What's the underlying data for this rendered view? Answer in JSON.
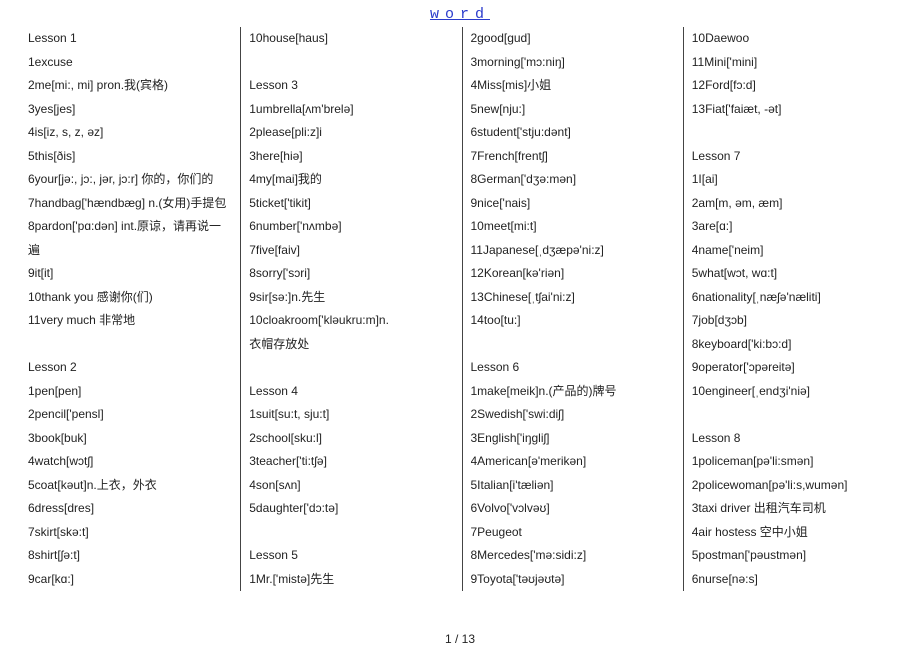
{
  "header": "word",
  "footer": "1  /  13",
  "columns": [
    [
      {
        "t": "text",
        "v": "Lesson 1"
      },
      {
        "t": "text",
        "v": "1excuse"
      },
      {
        "t": "text",
        "v": "2me[mi:, mi] pron.我(宾格)"
      },
      {
        "t": "text",
        "v": "3yes[jes]"
      },
      {
        "t": "text",
        "v": "4is[iz, s, z, əz]"
      },
      {
        "t": "text",
        "v": "5this[ðis]"
      },
      {
        "t": "text",
        "v": "6your[jə:, jɔ:, jər, jɔ:r]  你的，你们的"
      },
      {
        "t": "text",
        "v": "7handbag['hændbæg] n.(女用)手提包"
      },
      {
        "t": "text",
        "v": "8pardon['pɑ:dən] int.原谅，请再说一"
      },
      {
        "t": "text",
        "v": "遍"
      },
      {
        "t": "text",
        "v": "9it[it]"
      },
      {
        "t": "text",
        "v": "10thank you 感谢你(们)"
      },
      {
        "t": "text",
        "v": "11very much 非常地"
      },
      {
        "t": "blank"
      },
      {
        "t": "text",
        "v": "Lesson 2"
      },
      {
        "t": "text",
        "v": "1pen[pen]"
      },
      {
        "t": "text",
        "v": "2pencil['pensl]"
      },
      {
        "t": "text",
        "v": "3book[buk]"
      },
      {
        "t": "text",
        "v": "4watch[wɔtʃ]"
      },
      {
        "t": "text",
        "v": "5coat[kəut]n.上衣，外衣"
      },
      {
        "t": "text",
        "v": "6dress[dres]"
      },
      {
        "t": "text",
        "v": "7skirt[skə:t]"
      },
      {
        "t": "text",
        "v": "8shirt[ʃə:t]"
      },
      {
        "t": "text",
        "v": "9car[kɑ:]"
      }
    ],
    [
      {
        "t": "text",
        "v": "10house[haus]"
      },
      {
        "t": "blank"
      },
      {
        "t": "text",
        "v": "Lesson 3"
      },
      {
        "t": "text",
        "v": "1umbrella[ʌm'brelə]"
      },
      {
        "t": "text",
        "v": "2please[pli:z]i"
      },
      {
        "t": "text",
        "v": "3here[hiə]"
      },
      {
        "t": "text",
        "v": "4my[mai]我的"
      },
      {
        "t": "text",
        "v": "5ticket['tikit]"
      },
      {
        "t": "text",
        "v": "6number['nʌmbə]"
      },
      {
        "t": "text",
        "v": "7five[faiv]"
      },
      {
        "t": "text",
        "v": "8sorry['sɔri]"
      },
      {
        "t": "text",
        "v": "9sir[sə:]n.先生"
      },
      {
        "t": "text",
        "v": "10cloakroom['kləukru:m]n."
      },
      {
        "t": "text",
        "v": "衣帽存放处"
      },
      {
        "t": "blank"
      },
      {
        "t": "text",
        "v": "Lesson 4"
      },
      {
        "t": "text",
        "v": "1suit[su:t, sju:t]"
      },
      {
        "t": "text",
        "v": "2school[sku:l]"
      },
      {
        "t": "text",
        "v": "3teacher['ti:tʃə]"
      },
      {
        "t": "text",
        "v": "4son[sʌn]"
      },
      {
        "t": "text",
        "v": "5daughter['dɔ:tə]"
      },
      {
        "t": "blank"
      },
      {
        "t": "text",
        "v": "Lesson 5"
      },
      {
        "t": "text",
        "v": "1Mr.['mistə]先生"
      }
    ],
    [
      {
        "t": "text",
        "v": "2good[gud]"
      },
      {
        "t": "text",
        "v": "3morning['mɔ:niŋ]"
      },
      {
        "t": "text",
        "v": "4Miss[mis]小姐"
      },
      {
        "t": "text",
        "v": "5new[nju:]"
      },
      {
        "t": "text",
        "v": "6student['stju:dənt]"
      },
      {
        "t": "text",
        "v": "7French[frentʃ]"
      },
      {
        "t": "text",
        "v": "8German['dʒə:mən]"
      },
      {
        "t": "text",
        "v": "9nice['nais]"
      },
      {
        "t": "text",
        "v": "10meet[mi:t]"
      },
      {
        "t": "text",
        "v": "11Japanese[ˌdʒæpə'ni:z]"
      },
      {
        "t": "text",
        "v": "12Korean[kə'riən]"
      },
      {
        "t": "text",
        "v": "13Chinese[ˌtʃai'ni:z]"
      },
      {
        "t": "text",
        "v": "14too[tu:]"
      },
      {
        "t": "blank"
      },
      {
        "t": "text",
        "v": "Lesson 6"
      },
      {
        "t": "text",
        "v": "1make[meik]n.(产品的)牌号"
      },
      {
        "t": "text",
        "v": "2Swedish['swi:diʃ]"
      },
      {
        "t": "text",
        "v": "3English['iŋgliʃ]"
      },
      {
        "t": "text",
        "v": "4American[ə'merikən]"
      },
      {
        "t": "text",
        "v": "5Italian[i'tæliən]"
      },
      {
        "t": "text",
        "v": "6Volvo['vɔlvəʊ]"
      },
      {
        "t": "text",
        "v": "7Peugeot"
      },
      {
        "t": "text",
        "v": "8Mercedes['mə:sidi:z]"
      },
      {
        "t": "text",
        "v": "9Toyota['təʊjəʊtə]"
      }
    ],
    [
      {
        "t": "text",
        "v": "10Daewoo"
      },
      {
        "t": "text",
        "v": "11Mini['mini]"
      },
      {
        "t": "text",
        "v": "12Ford[fɔ:d]"
      },
      {
        "t": "text",
        "v": "13Fiat['faiæt, -ət]"
      },
      {
        "t": "blank"
      },
      {
        "t": "text",
        "v": "Lesson 7"
      },
      {
        "t": "text",
        "v": "1I[ai]"
      },
      {
        "t": "text",
        "v": "2am[m, əm, æm]"
      },
      {
        "t": "text",
        "v": "3are[ɑ:]"
      },
      {
        "t": "text",
        "v": "4name['neim]"
      },
      {
        "t": "text",
        "v": "5what[wɔt, wɑ:t]"
      },
      {
        "t": "text",
        "v": "6nationality[ˌnæʃə'næliti]"
      },
      {
        "t": "text",
        "v": "7job[dʒɔb]"
      },
      {
        "t": "text",
        "v": "8keyboard['ki:bɔ:d]"
      },
      {
        "t": "text",
        "v": "9operator['ɔpəreitə]"
      },
      {
        "t": "text",
        "v": "10engineer[ˌendʒi'niə]"
      },
      {
        "t": "blank"
      },
      {
        "t": "text",
        "v": "Lesson 8"
      },
      {
        "t": "text",
        "v": "1policeman[pə'li:smən]"
      },
      {
        "t": "text",
        "v": "2policewoman[pə'li:s,wumən]"
      },
      {
        "t": "text",
        "v": "3taxi driver 出租汽车司机"
      },
      {
        "t": "text",
        "v": "4air hostess 空中小姐"
      },
      {
        "t": "text",
        "v": "5postman['pəustmən]"
      },
      {
        "t": "text",
        "v": "6nurse[nə:s]"
      }
    ]
  ]
}
